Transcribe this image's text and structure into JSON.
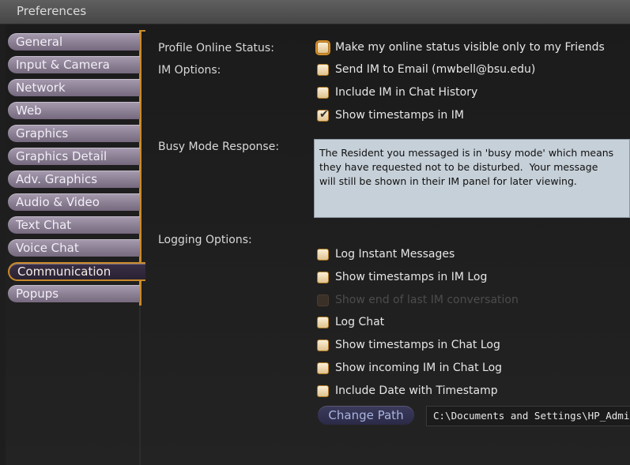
{
  "window": {
    "title": "Preferences"
  },
  "tabs": [
    {
      "label": "General"
    },
    {
      "label": "Input & Camera"
    },
    {
      "label": "Network"
    },
    {
      "label": "Web"
    },
    {
      "label": "Graphics"
    },
    {
      "label": "Graphics Detail"
    },
    {
      "label": "Adv. Graphics"
    },
    {
      "label": "Audio & Video"
    },
    {
      "label": "Text Chat"
    },
    {
      "label": "Voice Chat"
    },
    {
      "label": "Communication",
      "active": true
    },
    {
      "label": "Popups"
    }
  ],
  "sections": {
    "profile_status_label": "Profile Online Status:",
    "im_options_label": "IM Options:",
    "busy_mode_label": "Busy Mode Response:",
    "logging_label": "Logging Options:"
  },
  "options": {
    "online_friends_only": {
      "label": "Make my online status visible only to my Friends",
      "checked": false
    },
    "send_im_email": {
      "label": "Send IM to Email (mwbell@bsu.edu)",
      "checked": false
    },
    "include_im_chat_history": {
      "label": "Include IM in Chat History",
      "checked": false
    },
    "show_timestamps_im": {
      "label": "Show timestamps in IM",
      "checked": true
    },
    "log_instant_messages": {
      "label": "Log Instant Messages",
      "checked": false
    },
    "show_timestamps_im_log": {
      "label": "Show timestamps in IM Log",
      "checked": false
    },
    "show_end_last_im": {
      "label": "Show end of last IM conversation",
      "checked": false,
      "disabled": true
    },
    "log_chat": {
      "label": "Log Chat",
      "checked": false
    },
    "show_timestamps_chat_log": {
      "label": "Show timestamps in Chat Log",
      "checked": false
    },
    "show_incoming_im_chat_log": {
      "label": "Show incoming IM in Chat Log",
      "checked": false
    },
    "include_date_timestamp": {
      "label": "Include Date with Timestamp",
      "checked": false
    }
  },
  "busy_response": {
    "value": "The Resident you messaged is in 'busy mode' which means\nthey have requested not to be disturbed.  Your message\nwill still be shown in their IM panel for later viewing."
  },
  "log_path": {
    "button_label": "Change Path",
    "value": "C:\\Documents and Settings\\HP_Admin"
  },
  "colors": {
    "accent": "#c98a2a",
    "tab_bg": "#8a7f93",
    "active_tab_bg": "#2a2233",
    "busy_box_bg": "#c6d0d8"
  }
}
